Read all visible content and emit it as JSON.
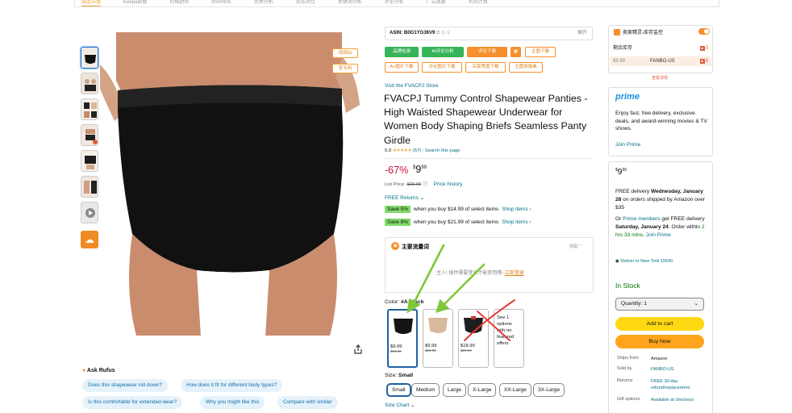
{
  "top_tabs": [
    "商品详情",
    "Keepa数据",
    "价格趋势",
    "BSR排名",
    "变体分析",
    "竞品对比",
    "关键词分析",
    "评论分析",
    "广告数据",
    "利润计算"
  ],
  "image_tags": {
    "find_similar": "找相似",
    "check_patent": "查专利"
  },
  "rufus": {
    "title": "Ask Rufus",
    "questions": [
      "Does this shapewear roll down?",
      "How does it fit for different body types?",
      "Is this comfortable for extended wear?",
      "Why you might like this",
      "Compare with similar"
    ]
  },
  "asin_bar": {
    "asin": "ASIN: B0G1YG36V9",
    "expand": "展开"
  },
  "toolbar": {
    "row1": [
      "品牌检测",
      "AI评论分析",
      "评论下载",
      "",
      "主图下载"
    ],
    "row2": [
      "A+图片下载",
      "评论图片下载",
      "买家秀图下载",
      "主图原像素"
    ]
  },
  "product": {
    "store": "Visit the FVACPJ Store",
    "title": "FVACPJ Tummy Control Shapewear Panties - High Waisted Shapewear Underwear for Women Body Shaping Briefs Seamless Panty Girdle",
    "rating_value": "5.0",
    "rating_stars": "★★★★★",
    "rating_count": "(57)",
    "search_page": "Search this page",
    "discount": "-67%",
    "price_whole": "9",
    "price_fraction": "99",
    "price_symbol": "$",
    "list_price_label": "List Price:",
    "list_price": "$29.99",
    "price_history": "Price history",
    "free_returns": "FREE Returns",
    "save_offers": [
      {
        "badge": "Save 5%",
        "text": "when you buy $14.99 of select items",
        "link": "Shop items ›"
      },
      {
        "badge": "Save 8%",
        "text": "when you buy $21.99 of select items",
        "link": "Shop items ›"
      }
    ]
  },
  "keywords": {
    "title": "主要流量词",
    "collapse": "收起",
    "message": "主人! 插件需要登录才能使用哦~",
    "login": "立即登录"
  },
  "color": {
    "label": "Color:",
    "selected": "#A Black",
    "options": [
      {
        "price": "$9.99",
        "was": "$29.99",
        "tone": "#141414"
      },
      {
        "price": "$9.99",
        "was": "$29.99",
        "tone": "#d9b99b"
      },
      {
        "price": "$18.99",
        "was": "$29.99",
        "tone": "#1e1e1e"
      }
    ],
    "no_offer_text": "See 1 options with no featured offers"
  },
  "size": {
    "label": "Size:",
    "selected": "Small",
    "options": [
      "Small",
      "Medium",
      "Large",
      "X-Large",
      "XX-Large",
      "3X-Large"
    ],
    "chart": "Size Chart"
  },
  "seller_panel": {
    "title": "卖家精灵-库存监控",
    "stock_label": "剩余库存",
    "stock_qty_1": "5",
    "price": "$9.99",
    "seller": "FANBO-US",
    "stock_qty_2": "5",
    "more": "查看详情"
  },
  "prime": {
    "logo": "prime",
    "text": "Enjoy fast, free delivery, exclusive deals, and award-winning movies & TV shows.",
    "join": "Join Prime"
  },
  "buybox": {
    "price_whole": "9",
    "price_fraction": "99",
    "price_symbol": "$",
    "delivery_1_pre": "FREE delivery ",
    "delivery_1_date": "Wednesday, January 28",
    "delivery_1_post": " on orders shipped by Amazon over $35",
    "delivery_2_pre": "Or ",
    "delivery_2_link": "Prime members",
    "delivery_2_mid": " get FREE delivery ",
    "delivery_2_date": "Saturday, January 24",
    "delivery_2_post": ". Order within ",
    "delivery_2_time": "2 hrs 33 mins",
    "delivery_2_join": "Join Prime",
    "deliver_to": "Deliver to New York 10040",
    "in_stock": "In Stock",
    "quantity": "Quantity: 1",
    "add_to_cart": "Add to cart",
    "buy_now": "Buy Now",
    "info": [
      {
        "k": "Ships from",
        "v": "Amazon",
        "plain": true
      },
      {
        "k": "Sold by",
        "v": "FANBO-US",
        "plain": false
      },
      {
        "k": "Returns",
        "v": "FREE 30-day refund/replacement",
        "plain": false
      },
      {
        "k": "Gift options",
        "v": "Available at checkout",
        "plain": false
      }
    ]
  },
  "colors": {
    "prime_blue": "#1a8ee3",
    "cart_yellow": "#ffd814",
    "buy_orange": "#ffa41c",
    "tool_green": "#37b35a",
    "tool_orange": "#f5902d",
    "annotation_green": "#7ec83a",
    "annotation_red": "#e53935"
  }
}
